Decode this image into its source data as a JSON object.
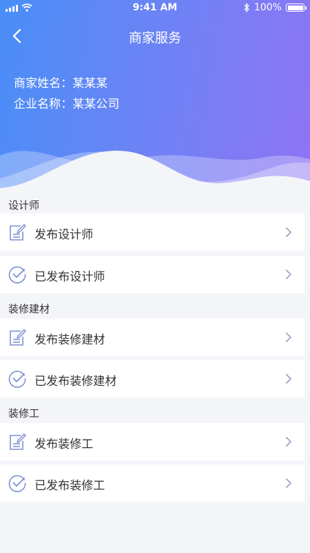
{
  "status": {
    "time": "9:41 AM",
    "battery_text": "100%",
    "battery_level": 1.0
  },
  "nav": {
    "title": "商家服务",
    "back_icon": "chevron-left-icon"
  },
  "merchant": {
    "name_line": "商家姓名：某某某",
    "company_line": "企业名称：某某公司"
  },
  "sections": [
    {
      "title": "设计师",
      "items": [
        {
          "label": "发布设计师",
          "icon": "edit-document-icon"
        },
        {
          "label": "已发布设计师",
          "icon": "check-circle-icon"
        }
      ]
    },
    {
      "title": "装修建材",
      "items": [
        {
          "label": "发布装修建材",
          "icon": "edit-document-icon"
        },
        {
          "label": "已发布装修建材",
          "icon": "check-circle-icon"
        }
      ]
    },
    {
      "title": "装修工",
      "items": [
        {
          "label": "发布装修工",
          "icon": "edit-document-icon"
        },
        {
          "label": "已发布装修工",
          "icon": "check-circle-icon"
        }
      ]
    }
  ],
  "colors": {
    "header_gradient_start": "#4a8ef7",
    "header_gradient_end": "#8f74f4",
    "icon_stroke": "#7b8fd6",
    "chevron": "#9aa3c8",
    "page_bg": "#f4f5f9"
  }
}
